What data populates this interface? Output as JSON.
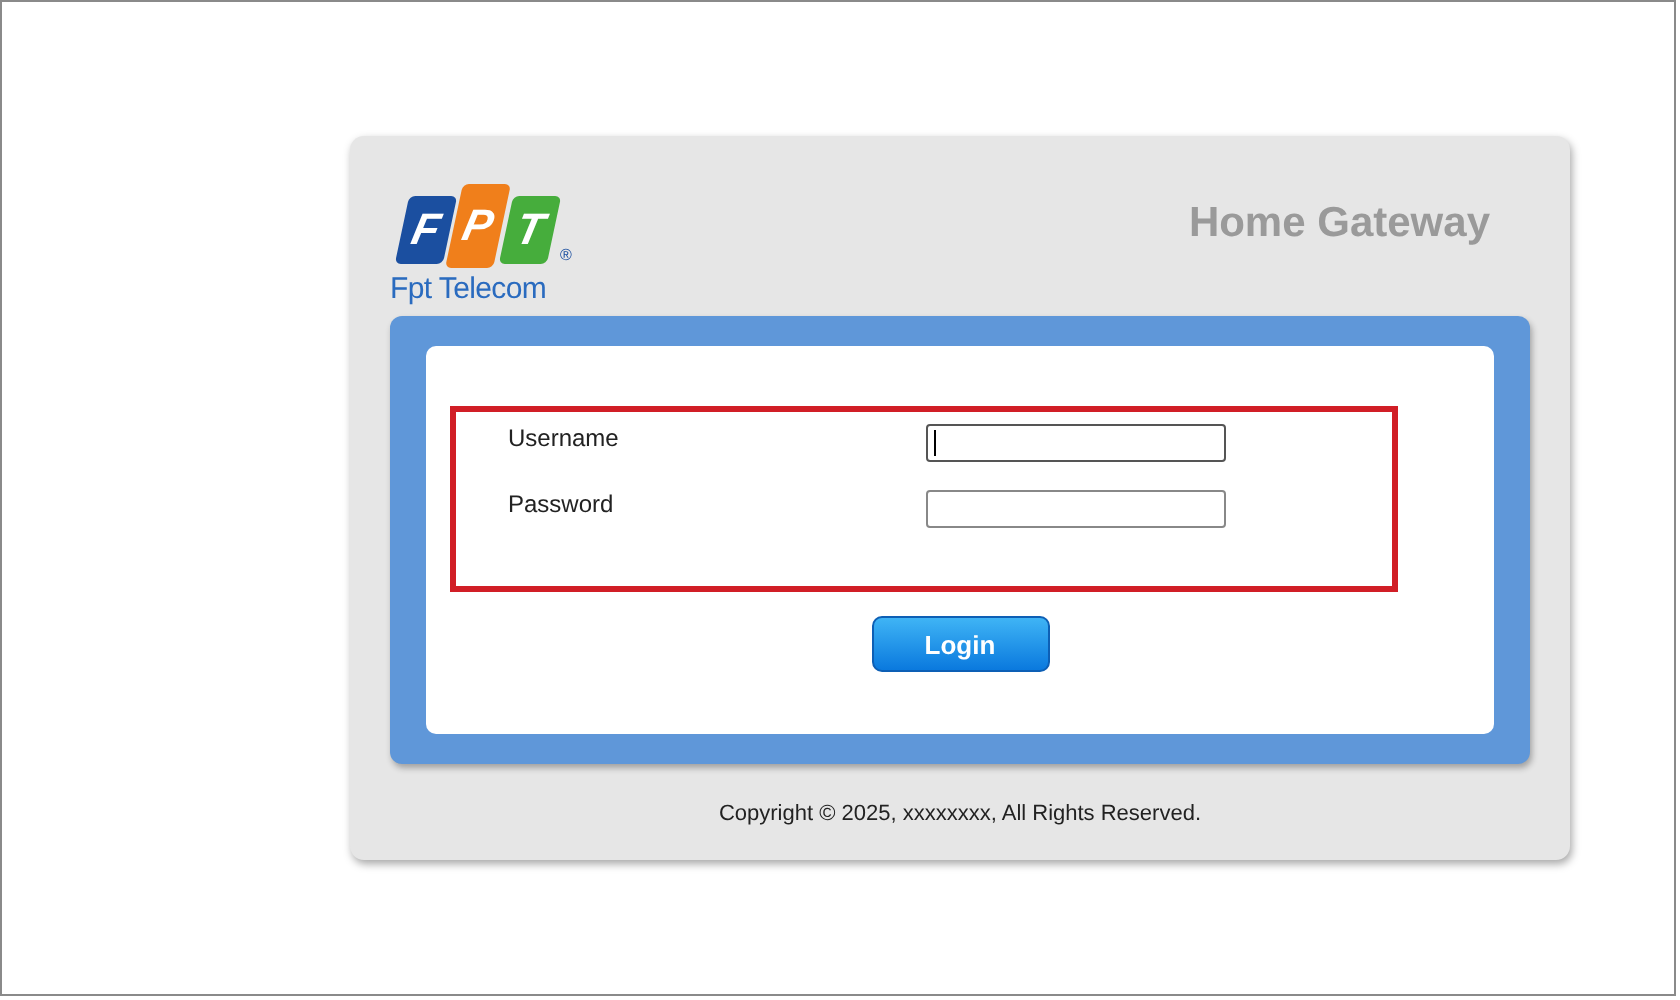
{
  "logo": {
    "letters": [
      "F",
      "P",
      "T"
    ],
    "mark": "®",
    "company": "Fpt Telecom"
  },
  "title": "Home Gateway",
  "form": {
    "highlighted": true,
    "fields": [
      {
        "label": "Username",
        "focused": true
      },
      {
        "label": "Password",
        "focused": false
      }
    ]
  },
  "login_button": "Login",
  "footer": "Copyright © 2025, xxxxxxxx, All Rights Reserved."
}
